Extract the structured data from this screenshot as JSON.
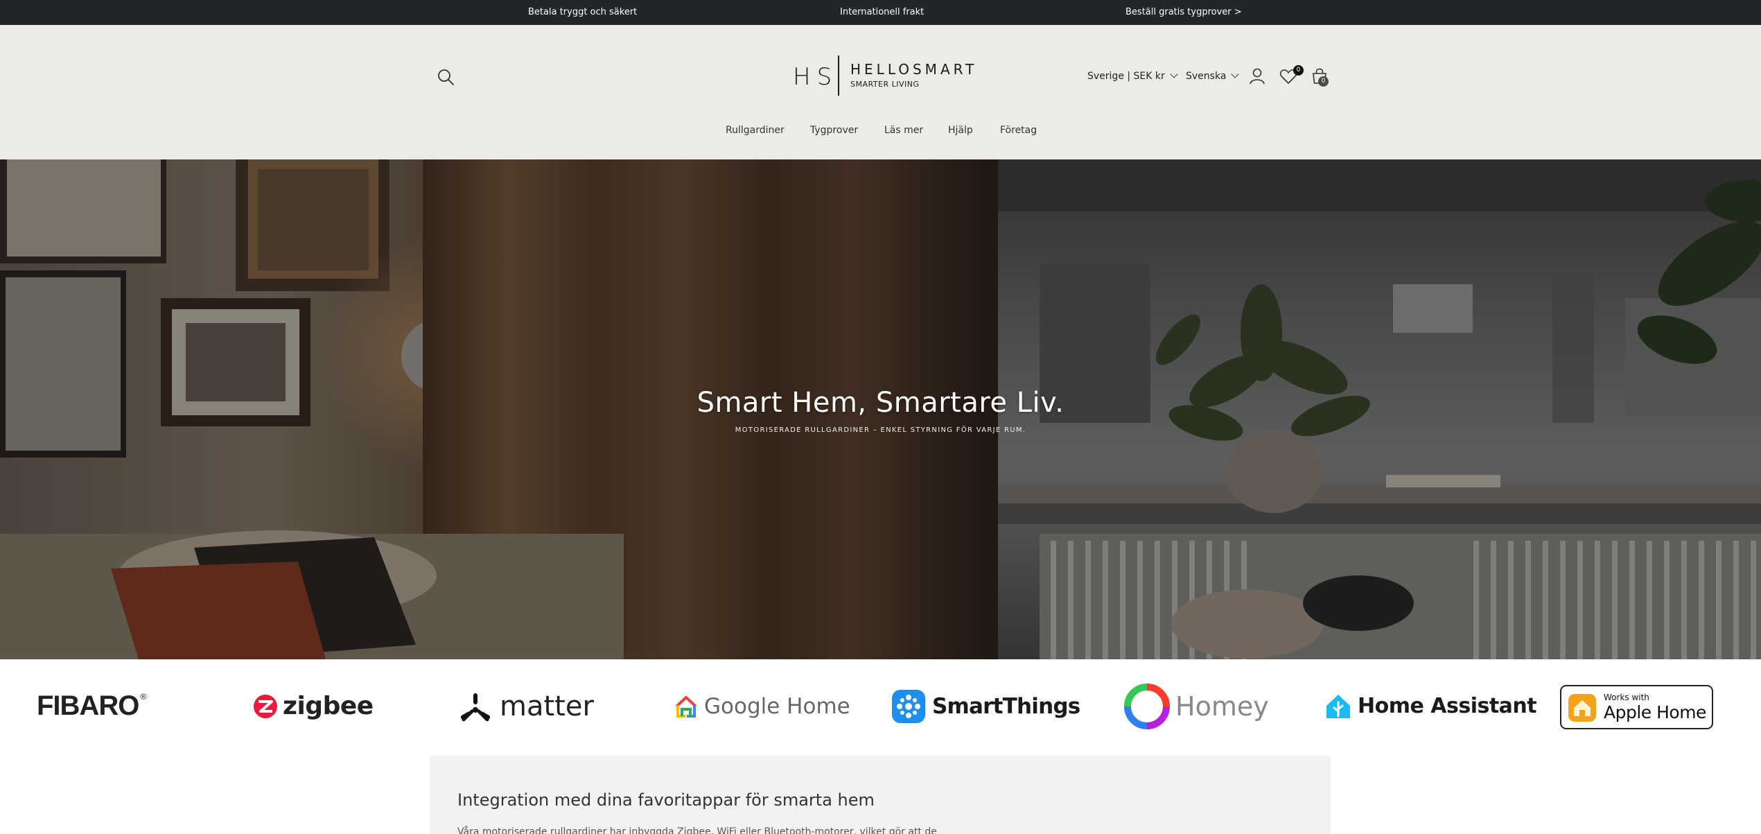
{
  "announcement": {
    "item1": "Betala tryggt och säkert",
    "item2": "Internationell frakt",
    "item3": "Beställ gratis tygprover >"
  },
  "header": {
    "logo_mark": "HS",
    "logo_name": "HELLOSMART",
    "logo_tagline": "SMARTER LIVING",
    "country_selector": "Sverige | SEK kr",
    "language_selector": "Svenska",
    "wishlist_count": "0",
    "cart_count": "0",
    "icons": [
      "search-icon",
      "account-icon",
      "heart-icon",
      "cart-icon",
      "chevron-down-icon"
    ]
  },
  "nav": {
    "items": [
      "Rullgardiner",
      "Tygprover",
      "Läs mer",
      "Hjälp",
      "Företag"
    ]
  },
  "hero": {
    "title": "Smart Hem, Smartare Liv.",
    "subtitle": "MOTORISERADE RULLGARDINER – ENKEL STYRNING FÖR VARJE RUM."
  },
  "brands": {
    "fibaro": "FIBARO",
    "fibaro_mark": "®",
    "zigbee": "zigbee",
    "matter": "matter",
    "google_home": "Google Home",
    "smartthings": "SmartThings",
    "homey": "Homey",
    "home_assistant": "Home Assistant",
    "apple_small": "Works with",
    "apple_big": "Apple Home"
  },
  "integration": {
    "title": "Integration med dina favoritappar för smarta hem",
    "body": "Våra motoriserade rullgardiner har inbyggda Zigbee, WiFi eller Bluetooth-motorer, vilket gör att de"
  },
  "colors": {
    "announce_bg": "#22252a",
    "header_bg": "#ecebe7",
    "integration_bg": "#f2f2f2"
  }
}
